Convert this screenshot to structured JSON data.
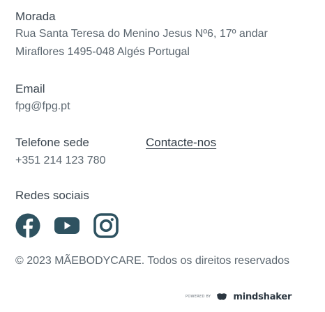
{
  "address": {
    "label": "Morada",
    "line1": "Rua Santa Teresa do Menino Jesus Nº6, 17º andar",
    "line2": "Miraflores 1495-048 Algés Portugal"
  },
  "email": {
    "label": "Email",
    "value": "fpg@fpg.pt"
  },
  "phone": {
    "label": "Telefone sede",
    "value": "+351 214 123 780",
    "contact_link": "Contacte-nos"
  },
  "social": {
    "label": "Redes sociais",
    "icons": [
      "facebook-icon",
      "youtube-icon",
      "instagram-icon"
    ],
    "icon_color": "#2e5260"
  },
  "copyright": "© 2023 MÃEBODYCARE. Todos os direitos reservados",
  "powered": {
    "prefix": "POWERED BY",
    "brand": "mindshaker"
  }
}
